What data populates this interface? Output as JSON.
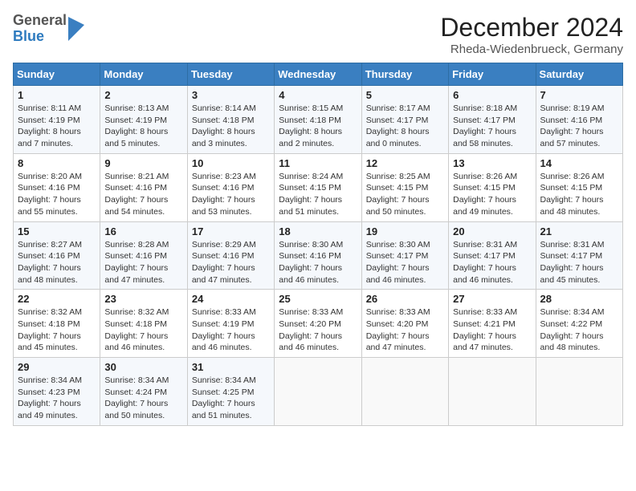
{
  "header": {
    "logo": {
      "general": "General",
      "blue": "Blue"
    },
    "title": "December 2024",
    "subtitle": "Rheda-Wiedenbrueck, Germany"
  },
  "calendar": {
    "weekdays": [
      "Sunday",
      "Monday",
      "Tuesday",
      "Wednesday",
      "Thursday",
      "Friday",
      "Saturday"
    ],
    "weeks": [
      [
        {
          "day": 1,
          "sunrise": "8:11 AM",
          "sunset": "4:19 PM",
          "daylight": "8 hours and 7 minutes."
        },
        {
          "day": 2,
          "sunrise": "8:13 AM",
          "sunset": "4:19 PM",
          "daylight": "8 hours and 5 minutes."
        },
        {
          "day": 3,
          "sunrise": "8:14 AM",
          "sunset": "4:18 PM",
          "daylight": "8 hours and 3 minutes."
        },
        {
          "day": 4,
          "sunrise": "8:15 AM",
          "sunset": "4:18 PM",
          "daylight": "8 hours and 2 minutes."
        },
        {
          "day": 5,
          "sunrise": "8:17 AM",
          "sunset": "4:17 PM",
          "daylight": "8 hours and 0 minutes."
        },
        {
          "day": 6,
          "sunrise": "8:18 AM",
          "sunset": "4:17 PM",
          "daylight": "7 hours and 58 minutes."
        },
        {
          "day": 7,
          "sunrise": "8:19 AM",
          "sunset": "4:16 PM",
          "daylight": "7 hours and 57 minutes."
        }
      ],
      [
        {
          "day": 8,
          "sunrise": "8:20 AM",
          "sunset": "4:16 PM",
          "daylight": "7 hours and 55 minutes."
        },
        {
          "day": 9,
          "sunrise": "8:21 AM",
          "sunset": "4:16 PM",
          "daylight": "7 hours and 54 minutes."
        },
        {
          "day": 10,
          "sunrise": "8:23 AM",
          "sunset": "4:16 PM",
          "daylight": "7 hours and 53 minutes."
        },
        {
          "day": 11,
          "sunrise": "8:24 AM",
          "sunset": "4:15 PM",
          "daylight": "7 hours and 51 minutes."
        },
        {
          "day": 12,
          "sunrise": "8:25 AM",
          "sunset": "4:15 PM",
          "daylight": "7 hours and 50 minutes."
        },
        {
          "day": 13,
          "sunrise": "8:26 AM",
          "sunset": "4:15 PM",
          "daylight": "7 hours and 49 minutes."
        },
        {
          "day": 14,
          "sunrise": "8:26 AM",
          "sunset": "4:15 PM",
          "daylight": "7 hours and 48 minutes."
        }
      ],
      [
        {
          "day": 15,
          "sunrise": "8:27 AM",
          "sunset": "4:16 PM",
          "daylight": "7 hours and 48 minutes."
        },
        {
          "day": 16,
          "sunrise": "8:28 AM",
          "sunset": "4:16 PM",
          "daylight": "7 hours and 47 minutes."
        },
        {
          "day": 17,
          "sunrise": "8:29 AM",
          "sunset": "4:16 PM",
          "daylight": "7 hours and 47 minutes."
        },
        {
          "day": 18,
          "sunrise": "8:30 AM",
          "sunset": "4:16 PM",
          "daylight": "7 hours and 46 minutes."
        },
        {
          "day": 19,
          "sunrise": "8:30 AM",
          "sunset": "4:17 PM",
          "daylight": "7 hours and 46 minutes."
        },
        {
          "day": 20,
          "sunrise": "8:31 AM",
          "sunset": "4:17 PM",
          "daylight": "7 hours and 46 minutes."
        },
        {
          "day": 21,
          "sunrise": "8:31 AM",
          "sunset": "4:17 PM",
          "daylight": "7 hours and 45 minutes."
        }
      ],
      [
        {
          "day": 22,
          "sunrise": "8:32 AM",
          "sunset": "4:18 PM",
          "daylight": "7 hours and 45 minutes."
        },
        {
          "day": 23,
          "sunrise": "8:32 AM",
          "sunset": "4:18 PM",
          "daylight": "7 hours and 46 minutes."
        },
        {
          "day": 24,
          "sunrise": "8:33 AM",
          "sunset": "4:19 PM",
          "daylight": "7 hours and 46 minutes."
        },
        {
          "day": 25,
          "sunrise": "8:33 AM",
          "sunset": "4:20 PM",
          "daylight": "7 hours and 46 minutes."
        },
        {
          "day": 26,
          "sunrise": "8:33 AM",
          "sunset": "4:20 PM",
          "daylight": "7 hours and 47 minutes."
        },
        {
          "day": 27,
          "sunrise": "8:33 AM",
          "sunset": "4:21 PM",
          "daylight": "7 hours and 47 minutes."
        },
        {
          "day": 28,
          "sunrise": "8:34 AM",
          "sunset": "4:22 PM",
          "daylight": "7 hours and 48 minutes."
        }
      ],
      [
        {
          "day": 29,
          "sunrise": "8:34 AM",
          "sunset": "4:23 PM",
          "daylight": "7 hours and 49 minutes."
        },
        {
          "day": 30,
          "sunrise": "8:34 AM",
          "sunset": "4:24 PM",
          "daylight": "7 hours and 50 minutes."
        },
        {
          "day": 31,
          "sunrise": "8:34 AM",
          "sunset": "4:25 PM",
          "daylight": "7 hours and 51 minutes."
        },
        null,
        null,
        null,
        null
      ]
    ]
  }
}
